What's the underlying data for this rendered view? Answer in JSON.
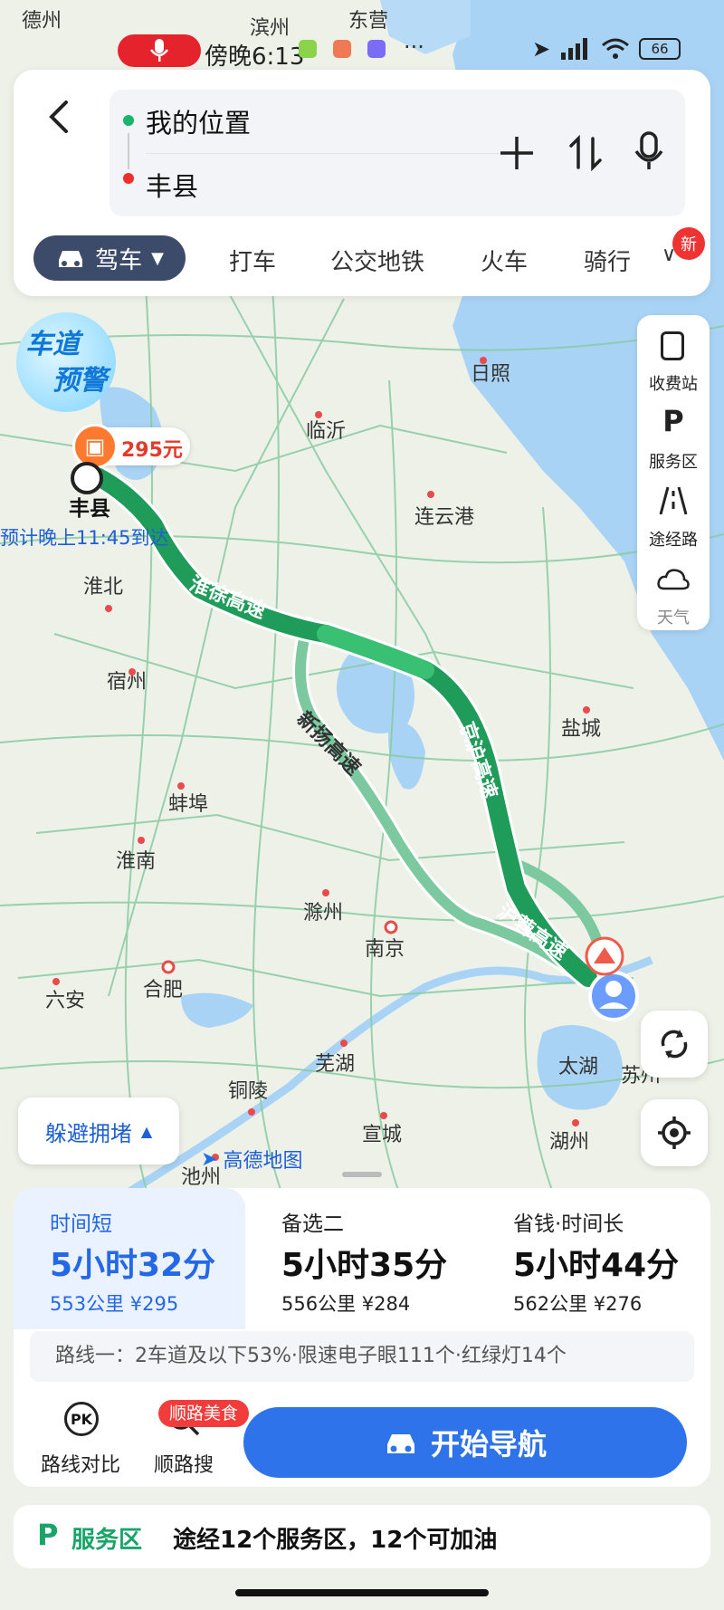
{
  "status_bar": {
    "time": "傍晚6:13",
    "dots": "···",
    "battery": "66"
  },
  "route_search": {
    "origin": "我的位置",
    "destination": "丰县"
  },
  "modes": {
    "active": "驾车",
    "items": [
      "打车",
      "公交地铁",
      "火车",
      "骑行"
    ],
    "new_badge": "新"
  },
  "map": {
    "logo_line1": "车道",
    "logo_line2": "预警",
    "toll_price": "295元",
    "destination_label": "丰县",
    "eta": "预计晚上11:45到达",
    "cities": [
      {
        "name": "德州"
      },
      {
        "name": "滨州"
      },
      {
        "name": "东营"
      },
      {
        "name": "日照"
      },
      {
        "name": "临沂"
      },
      {
        "name": "连云港"
      },
      {
        "name": "淮北"
      },
      {
        "name": "宿州"
      },
      {
        "name": "盐城"
      },
      {
        "name": "蚌埠"
      },
      {
        "name": "淮南"
      },
      {
        "name": "滁州"
      },
      {
        "name": "南京"
      },
      {
        "name": "合肥"
      },
      {
        "name": "六安"
      },
      {
        "name": "芜湖"
      },
      {
        "name": "太湖"
      },
      {
        "name": "苏州"
      },
      {
        "name": "铜陵"
      },
      {
        "name": "宣城"
      },
      {
        "name": "湖州"
      },
      {
        "name": "池州"
      }
    ],
    "highways": [
      "淮徐高速",
      "京沪高速",
      "新扬高速",
      "沪蓉高速"
    ],
    "attribution": "高德地图",
    "side_tools": [
      "收费站",
      "服务区",
      "途经路",
      "天气"
    ],
    "avoid_label": "躲避拥堵"
  },
  "routes": [
    {
      "label": "时间短",
      "time": "5小时32分",
      "detail": "553公里 ¥295"
    },
    {
      "label": "备选二",
      "time": "5小时35分",
      "detail": "556公里 ¥284"
    },
    {
      "label": "省钱·时间长",
      "time": "5小时44分",
      "detail": "562公里 ¥276"
    }
  ],
  "route_info": "路线一：2车道及以下53%·限速电子眼111个·红绿灯14个",
  "actions": {
    "compare": "路线对比",
    "search_along": "顺路搜",
    "food_badge": "顺路美食",
    "start_nav": "开始导航"
  },
  "service_area": {
    "title": "服务区",
    "summary": "途经12个服务区，12个可加油"
  },
  "colors": {
    "route_main": "#1f9b5a",
    "route_alt": "#7cc9a0",
    "accent": "#2f73ea",
    "water": "#a9d3f5"
  }
}
